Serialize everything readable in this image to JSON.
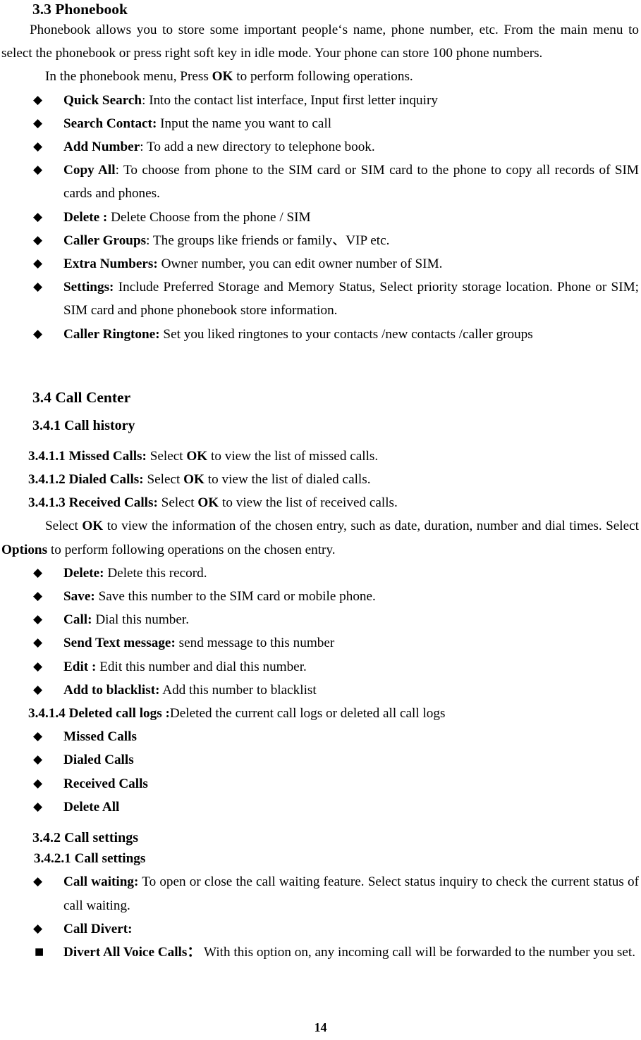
{
  "document": {
    "page_number": "14"
  },
  "sections": {
    "phonebook": {
      "heading": "3.3 Phonebook",
      "intro": "Phonebook allows you to store some important people‘s name, phone number, etc. From the main menu to select the phonebook or press right soft key in idle mode. Your phone can store 100 phone numbers.",
      "menu_note_pre": "In the phonebook menu, Press ",
      "menu_note_key": "OK",
      "menu_note_post": " to perform following operations.",
      "items": [
        {
          "bullet": "diamond",
          "label": "Quick Search",
          "sep": ":",
          "text": " Into the contact list interface, Input first letter inquiry"
        },
        {
          "bullet": "diamond",
          "label": "Search Contact:",
          "sep": "",
          "text": " Input the name you want to call"
        },
        {
          "bullet": "diamond",
          "label": "Add Number",
          "sep": ":",
          "text": " To add a new directory to telephone book."
        },
        {
          "bullet": "diamond",
          "label": "Copy All",
          "sep": ":",
          "text": " To choose from phone to the SIM card or SIM card to the phone to copy all records of SIM cards and phones."
        },
        {
          "bullet": "diamond",
          "label": "Delete :",
          "sep": "",
          "text": " Delete Choose from the phone / SIM"
        },
        {
          "bullet": "diamond",
          "label": "Caller Groups",
          "sep": ":",
          "text": " The groups like friends or family、VIP etc."
        },
        {
          "bullet": "diamond",
          "label": "Extra Numbers:",
          "sep": "",
          "text": " Owner number, you can edit owner number of SIM."
        },
        {
          "bullet": "diamond",
          "label": "Settings:",
          "sep": "",
          "text": " Include Preferred Storage and Memory Status, Select priority storage location. Phone or SIM; SIM card and phone phonebook store information."
        },
        {
          "bullet": "diamond",
          "label": "Caller Ringtone:",
          "sep": "",
          "text": " Set you liked ringtones to your contacts /new contacts /caller groups"
        }
      ]
    },
    "call_center": {
      "heading": "3.4 Call Center",
      "call_history": {
        "heading": "3.4.1 Call history",
        "missed": {
          "num": "3.4.1.1 Missed Calls:",
          "pre": " Select ",
          "key": "OK",
          "post": " to view the list of missed calls."
        },
        "dialed": {
          "num": "3.4.1.2 Dialed Calls:",
          "pre": " Select ",
          "key": "OK",
          "post": " to view the list of dialed calls."
        },
        "received": {
          "num": "3.4.1.3 Received Calls:",
          "pre": " Select ",
          "key": "OK",
          "post": " to view the list of received calls."
        },
        "options_para": {
          "pre": "Select ",
          "key1": "OK",
          "mid": " to view the information of the chosen entry, such as date, duration, number and dial times. Select ",
          "key2": "Options",
          "post": " to perform following operations on the chosen entry."
        },
        "options_items": [
          {
            "bullet": "diamond",
            "label": "Delete:",
            "text": " Delete this record."
          },
          {
            "bullet": "diamond",
            "label": "Save:",
            "text": " Save this number to the SIM card or mobile phone."
          },
          {
            "bullet": "diamond",
            "label": "Call:",
            "text": " Dial this number."
          },
          {
            "bullet": "diamond",
            "label": "Send Text message:",
            "text": " send message to this number"
          },
          {
            "bullet": "diamond",
            "label": "Edit :",
            "text": " Edit this number and dial this number."
          },
          {
            "bullet": "diamond",
            "label": "Add to blacklist:",
            "text": " Add this number to blacklist"
          }
        ],
        "deleted_logs": {
          "num": "3.4.1.4 Deleted call logs :",
          "text": "Deleted the current call logs or deleted all call logs"
        },
        "deleted_items": [
          {
            "bullet": "diamond",
            "label": "Missed Calls",
            "text": ""
          },
          {
            "bullet": "diamond",
            "label": "Dialed Calls",
            "text": ""
          },
          {
            "bullet": "diamond",
            "label": "Received Calls",
            "text": ""
          },
          {
            "bullet": "diamond",
            "label": "Delete All",
            "text": ""
          }
        ]
      },
      "call_settings": {
        "heading": "3.4.2 Call settings",
        "sub_heading": "3.4.2.1 Call settings",
        "items": [
          {
            "bullet": "diamond",
            "label": "Call waiting:",
            "text": " To open or close the call waiting feature. Select status inquiry to check the current status of call waiting."
          },
          {
            "bullet": "diamond",
            "label": "Call Divert:",
            "text": ""
          }
        ],
        "divert_items": [
          {
            "bullet": "square",
            "label": "Divert All Voice Calls",
            "sep": "：",
            "text": " With this option on, any incoming call will be forwarded to the number you set."
          }
        ]
      }
    }
  },
  "glyphs": {
    "diamond": "◆",
    "square": "■"
  }
}
